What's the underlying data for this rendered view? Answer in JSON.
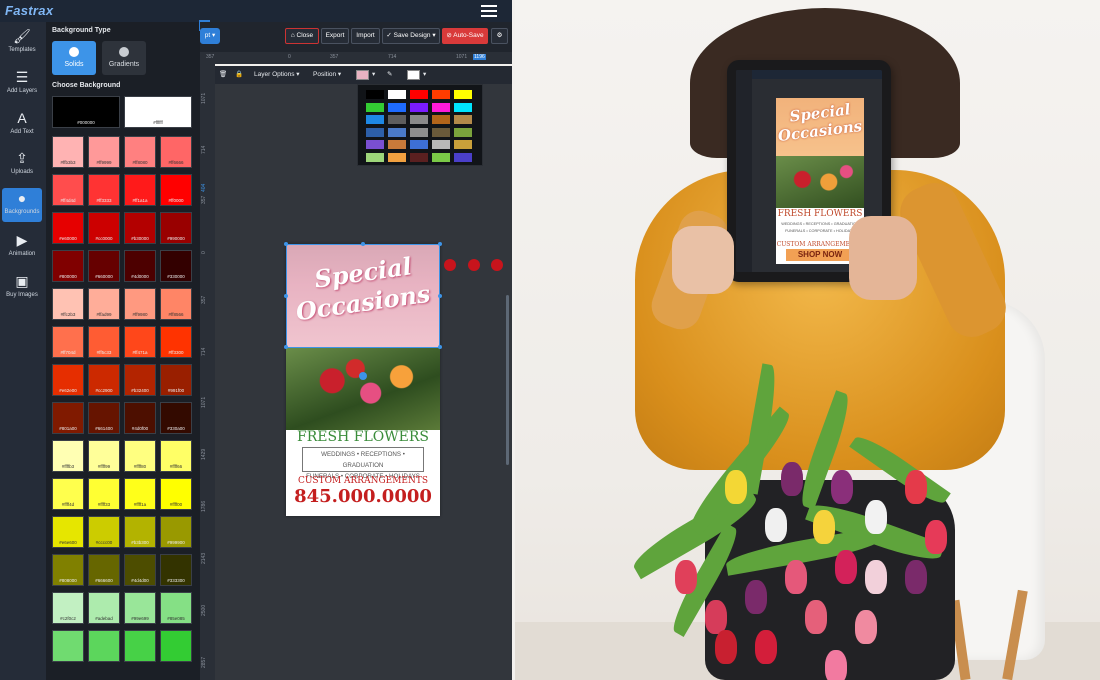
{
  "app": {
    "logo": "Fastrax",
    "menu_icon": "hamburger-menu-icon"
  },
  "sidebar": {
    "items": [
      {
        "label": "Templates",
        "icon": "brush-icon",
        "glyph": "🖌"
      },
      {
        "label": "Add Layers",
        "icon": "layers-list-icon",
        "glyph": "☰"
      },
      {
        "label": "Add Text",
        "icon": "text-icon",
        "glyph": "A"
      },
      {
        "label": "Uploads",
        "icon": "upload-icon",
        "glyph": "⇪"
      },
      {
        "label": "Backgrounds",
        "icon": "circle-icon",
        "glyph": "●"
      },
      {
        "label": "Animation",
        "icon": "video-camera-icon",
        "glyph": "▶"
      },
      {
        "label": "Buy Images",
        "icon": "image-icon",
        "glyph": "▣"
      }
    ]
  },
  "bg_panel": {
    "heading": "Background Type",
    "solids_label": "Solids",
    "gradients_label": "Gradients",
    "choose_heading": "Choose Background",
    "close_glyph": "×",
    "swatches": [
      {
        "hex": "#000000",
        "color": "#000000",
        "wide": true
      },
      {
        "hex": "#ffffff",
        "color": "#ffffff",
        "wide": true
      },
      {
        "hex": "#ffb3b3",
        "color": "#ffb3b3"
      },
      {
        "hex": "#ff9999",
        "color": "#ff9999"
      },
      {
        "hex": "#ff8080",
        "color": "#ff8080"
      },
      {
        "hex": "#ff6666",
        "color": "#ff6666"
      },
      {
        "hex": "#ff4d4d",
        "color": "#ff4d4d"
      },
      {
        "hex": "#ff3333",
        "color": "#ff3333"
      },
      {
        "hex": "#ff1a1a",
        "color": "#ff1a1a"
      },
      {
        "hex": "#ff0000",
        "color": "#ff0000"
      },
      {
        "hex": "#e60000",
        "color": "#e60000"
      },
      {
        "hex": "#cc0000",
        "color": "#cc0000"
      },
      {
        "hex": "#b30000",
        "color": "#b30000"
      },
      {
        "hex": "#990000",
        "color": "#990000"
      },
      {
        "hex": "#800000",
        "color": "#800000"
      },
      {
        "hex": "#660000",
        "color": "#660000"
      },
      {
        "hex": "#4d0000",
        "color": "#4d0000"
      },
      {
        "hex": "#330000",
        "color": "#330000"
      },
      {
        "hex": "#ffc2b3",
        "color": "#ffc2b3"
      },
      {
        "hex": "#ffad99",
        "color": "#ffad99"
      },
      {
        "hex": "#ff9980",
        "color": "#ff9980"
      },
      {
        "hex": "#ff8566",
        "color": "#ff8566"
      },
      {
        "hex": "#ff704d",
        "color": "#ff704d"
      },
      {
        "hex": "#ff5c33",
        "color": "#ff5c33"
      },
      {
        "hex": "#ff471a",
        "color": "#ff471a"
      },
      {
        "hex": "#ff3300",
        "color": "#ff3300"
      },
      {
        "hex": "#e62e00",
        "color": "#e62e00"
      },
      {
        "hex": "#cc2900",
        "color": "#cc2900"
      },
      {
        "hex": "#b32400",
        "color": "#b32400"
      },
      {
        "hex": "#991f00",
        "color": "#991f00"
      },
      {
        "hex": "#801a00",
        "color": "#801a00"
      },
      {
        "hex": "#661400",
        "color": "#661400"
      },
      {
        "hex": "#4d0f00",
        "color": "#4d0f00"
      },
      {
        "hex": "#330a00",
        "color": "#330a00"
      },
      {
        "hex": "#ffffb3",
        "color": "#ffffb3"
      },
      {
        "hex": "#ffff99",
        "color": "#ffff99"
      },
      {
        "hex": "#ffff80",
        "color": "#ffff80"
      },
      {
        "hex": "#ffff66",
        "color": "#ffff66"
      },
      {
        "hex": "#ffff4d",
        "color": "#ffff4d"
      },
      {
        "hex": "#ffff33",
        "color": "#ffff33"
      },
      {
        "hex": "#ffff1a",
        "color": "#ffff1a"
      },
      {
        "hex": "#ffff00",
        "color": "#ffff00"
      },
      {
        "hex": "#e6e600",
        "color": "#e6e600"
      },
      {
        "hex": "#cccc00",
        "color": "#cccc00"
      },
      {
        "hex": "#b3b300",
        "color": "#b3b300"
      },
      {
        "hex": "#999900",
        "color": "#999900"
      },
      {
        "hex": "#808000",
        "color": "#808000"
      },
      {
        "hex": "#666600",
        "color": "#666600"
      },
      {
        "hex": "#4d4d00",
        "color": "#4d4d00"
      },
      {
        "hex": "#333300",
        "color": "#333300"
      },
      {
        "hex": "#c2f0c2",
        "color": "#c2f0c2"
      },
      {
        "hex": "#adebad",
        "color": "#adebad"
      },
      {
        "hex": "#99e699",
        "color": "#99e699"
      },
      {
        "hex": "#85e085",
        "color": "#85e085"
      },
      {
        "hex": "",
        "color": "#70db70"
      },
      {
        "hex": "",
        "color": "#5cd65c"
      },
      {
        "hex": "",
        "color": "#47d147"
      },
      {
        "hex": "",
        "color": "#33cc33"
      }
    ]
  },
  "toolbar": {
    "pill_label": "pt ▾",
    "close_label": "Close",
    "export_label": "Export",
    "import_label": "Import",
    "save_label": "Save Design ▾",
    "autosave_label": "Auto-Save",
    "settings_icon": "gear-icon"
  },
  "ruler_h": [
    "357",
    "0",
    "357",
    "714",
    "1071",
    "1196"
  ],
  "ruler_v": [
    "1071",
    "714",
    "357",
    "404",
    "0",
    "357",
    "714",
    "1071",
    "1429",
    "1786",
    "2143",
    "2500",
    "2857"
  ],
  "layer_toolbar": {
    "layer_options_label": "Layer Options ▾",
    "position_label": "Position ▾",
    "fill_color": "#e8b3c2",
    "stroke_color": "#ffffff"
  },
  "color_popup": {
    "rows": [
      [
        "#000000",
        "#ffffff",
        "#ff0000",
        "#ff3c00",
        "#ffff00"
      ],
      [
        "#33cc33",
        "#1e6bff",
        "#7a1cff",
        "#ff1ad9",
        "#00e5ff"
      ],
      [
        "#1e88e5",
        "#5e5e5e",
        "#8a8a8a",
        "#b3651a",
        "#b38a4a"
      ],
      [
        "#2d5fa8",
        "#4a7ac9",
        "#8e8e8e",
        "#6a5a3a",
        "#7aa33c"
      ],
      [
        "#7a4fd1",
        "#c97a3a",
        "#3d6fd6",
        "#b8b8b8",
        "#c9a03a"
      ],
      [
        "#9ed67a",
        "#f0a040",
        "#5a2020",
        "#7ac947",
        "#4a3fc9"
      ]
    ]
  },
  "flyer": {
    "title_line1": "Special",
    "title_line2": "Occasions",
    "fresh": "FRESH FLOWERS",
    "services_line1": "WEDDINGS • RECEPTIONS • GRADUATION",
    "services_line2": "FUNERALS • CORPORATE • HOLIDAYS",
    "custom": "CUSTOM ARRANGEMENTS",
    "phone": "845.000.0000"
  },
  "tablet_flyer": {
    "title_line1": "Special",
    "title_line2": "Occasions",
    "fresh": "FRESH FLOWERS",
    "services_line1": "WEDDINGS • RECEPTIONS • GRADUATION",
    "services_line2": "FUNERALS • CORPORATE • HOLIDAYS",
    "custom": "CUSTOM ARRANGEMENTS",
    "shop": "SHOP NOW"
  },
  "colors": {
    "accent": "#2f7fd8",
    "connector": "#c8141c",
    "autosave": "#d93a3a"
  }
}
